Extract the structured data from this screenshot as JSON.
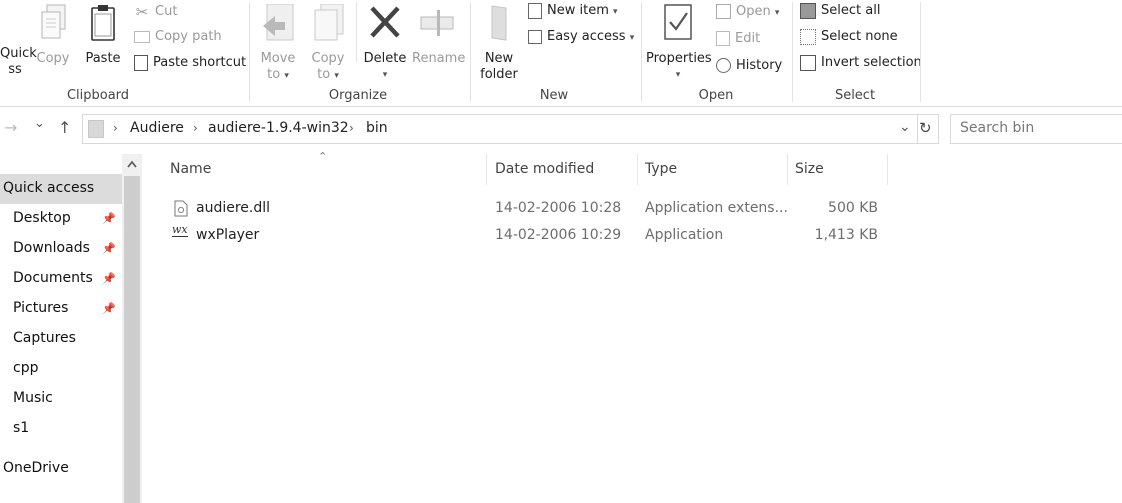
{
  "ribbon": {
    "clipboard": {
      "label": "Clipboard",
      "quick_access_line1": "Quick",
      "quick_access_line2": "ss",
      "copy": "Copy",
      "paste": "Paste",
      "cut": "Cut",
      "copy_path": "Copy path",
      "paste_shortcut": "Paste shortcut"
    },
    "organize": {
      "label": "Organize",
      "move_to_line1": "Move",
      "move_to_line2": "to",
      "copy_to_line1": "Copy",
      "copy_to_line2": "to",
      "delete": "Delete",
      "rename": "Rename"
    },
    "new": {
      "label": "New",
      "new_folder_line1": "New",
      "new_folder_line2": "folder",
      "new_item": "New item",
      "easy_access": "Easy access"
    },
    "open": {
      "label": "Open",
      "properties": "Properties",
      "open": "Open",
      "edit": "Edit",
      "history": "History"
    },
    "select": {
      "label": "Select",
      "select_all": "Select all",
      "select_none": "Select none",
      "invert_selection": "Invert selection"
    }
  },
  "address": {
    "breadcrumbs": [
      "Audiere",
      "audiere-1.9.4-win32",
      "bin"
    ],
    "search_placeholder": "Search bin"
  },
  "sidebar": {
    "items": [
      {
        "label": "Quick access",
        "pinned": false,
        "selected": true
      },
      {
        "label": "Desktop",
        "pinned": true
      },
      {
        "label": "Downloads",
        "pinned": true
      },
      {
        "label": "Documents",
        "pinned": true
      },
      {
        "label": "Pictures",
        "pinned": true
      },
      {
        "label": "Captures",
        "pinned": false
      },
      {
        "label": "cpp",
        "pinned": false
      },
      {
        "label": "Music",
        "pinned": false
      },
      {
        "label": "s1",
        "pinned": false
      },
      {
        "label": "OneDrive",
        "pinned": false
      }
    ]
  },
  "columns": [
    "Name",
    "Date modified",
    "Type",
    "Size"
  ],
  "files": [
    {
      "name": "audiere.dll",
      "date": "14-02-2006 10:28",
      "type": "Application extens...",
      "size": "500 KB",
      "icon": "dll-file-icon"
    },
    {
      "name": "wxPlayer",
      "date": "14-02-2006 10:29",
      "type": "Application",
      "size": "1,413 KB",
      "icon": "wx-app-icon"
    }
  ],
  "icons": {
    "pin": "📌",
    "nav_back": "←",
    "nav_forward": "→",
    "nav_dropdown": "⌄",
    "nav_up": "↑",
    "crumb_separator": "›",
    "dropdown_caret": "▾",
    "refresh": "↻",
    "sort_indicator": "⌃",
    "wx_mark": "wx"
  },
  "colors": {
    "selection": "#cce8ff",
    "sidebar_selected": "#dcdcdc",
    "accent": "#0063b1"
  }
}
